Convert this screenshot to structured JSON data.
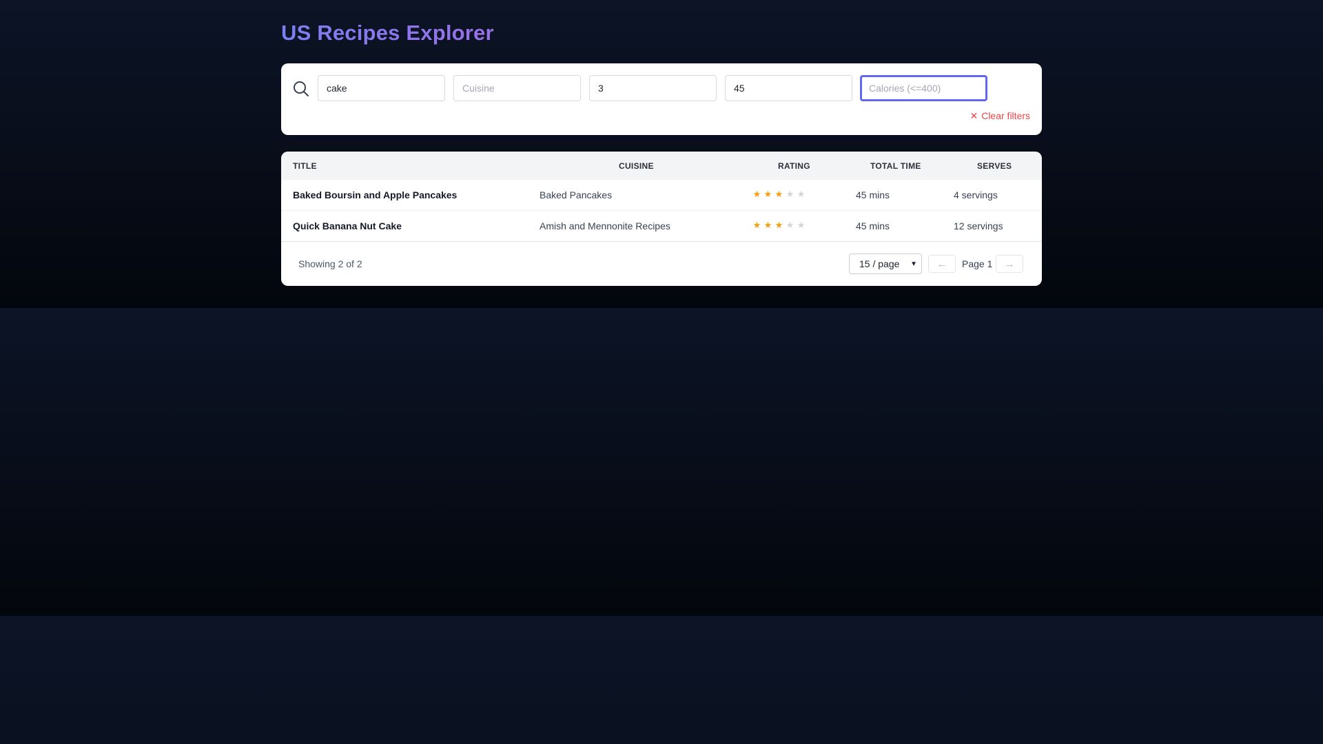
{
  "app": {
    "title": "US Recipes Explorer"
  },
  "filters": {
    "search": {
      "value": "cake",
      "placeholder": ""
    },
    "cuisine": {
      "value": "",
      "placeholder": "Cuisine"
    },
    "rating": {
      "value": "3",
      "placeholder": ""
    },
    "time": {
      "value": "45",
      "placeholder": ""
    },
    "calories": {
      "value": "",
      "placeholder": "Calories (<=400)"
    },
    "clear_label": "Clear filters",
    "clear_icon": "close-icon"
  },
  "table": {
    "headers": {
      "title": "TITLE",
      "cuisine": "CUISINE",
      "rating": "RATING",
      "time": "TOTAL TIME",
      "serves": "SERVES"
    },
    "rows": [
      {
        "title": "Baked Boursin and Apple Pancakes",
        "cuisine": "Baked Pancakes",
        "rating": 3,
        "rating_max": 5,
        "time": "45 mins",
        "serves": "4 servings"
      },
      {
        "title": "Quick Banana Nut Cake",
        "cuisine": "Amish and Mennonite Recipes",
        "rating": 3,
        "rating_max": 5,
        "time": "45 mins",
        "serves": "12 servings"
      }
    ]
  },
  "pagination": {
    "showing": "Showing 2 of 2",
    "page_size": "15 / page",
    "page_label": "Page 1",
    "prev_icon": "arrow-left-icon",
    "next_icon": "arrow-right-icon"
  },
  "colors": {
    "accent": "#6366f1",
    "star_on": "#f59e0b",
    "star_off": "#d1d5db",
    "danger": "#ef4444"
  }
}
